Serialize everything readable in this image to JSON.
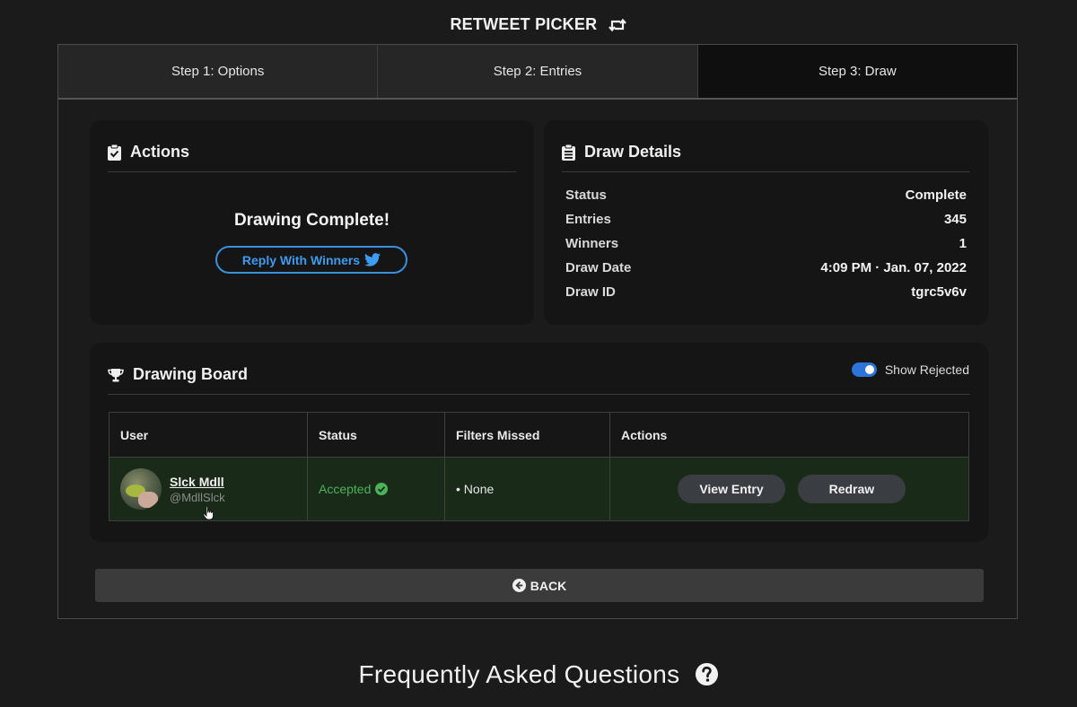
{
  "app": {
    "title": "RETWEET PICKER",
    "icon": "retweet-icon"
  },
  "steps": [
    {
      "label": "Step 1: Options"
    },
    {
      "label": "Step 2: Entries"
    },
    {
      "label": "Step 3: Draw",
      "active": true
    }
  ],
  "actions_card": {
    "title": "Actions",
    "icon": "clipboard-check-icon",
    "message": "Drawing Complete!",
    "reply_button": "Reply With Winners",
    "reply_icon": "twitter-icon"
  },
  "details_card": {
    "title": "Draw Details",
    "icon": "clipboard-list-icon",
    "rows": [
      {
        "key": "Status",
        "value": "Complete"
      },
      {
        "key": "Entries",
        "value": "345"
      },
      {
        "key": "Winners",
        "value": "1"
      },
      {
        "key": "Draw Date",
        "value": "4:09 PM · Jan. 07, 2022"
      },
      {
        "key": "Draw ID",
        "value": "tgrc5v6v"
      }
    ]
  },
  "board": {
    "title": "Drawing Board",
    "icon": "trophy-icon",
    "show_rejected_label": "Show Rejected",
    "show_rejected": true,
    "columns": [
      "User",
      "Status",
      "Filters Missed",
      "Actions"
    ],
    "rows": [
      {
        "name": "Slck Mdll",
        "handle": "@MdllSlck",
        "status": "Accepted",
        "filters_missed": "• None",
        "view_button": "View Entry",
        "redraw_button": "Redraw"
      }
    ]
  },
  "back_button": "BACK",
  "faq_heading": "Frequently Asked Questions",
  "colors": {
    "background": "#1b1b1b",
    "accent_blue": "#3d9bf0",
    "success_green": "#4cb25a",
    "row_highlight": "#1a2a19"
  }
}
